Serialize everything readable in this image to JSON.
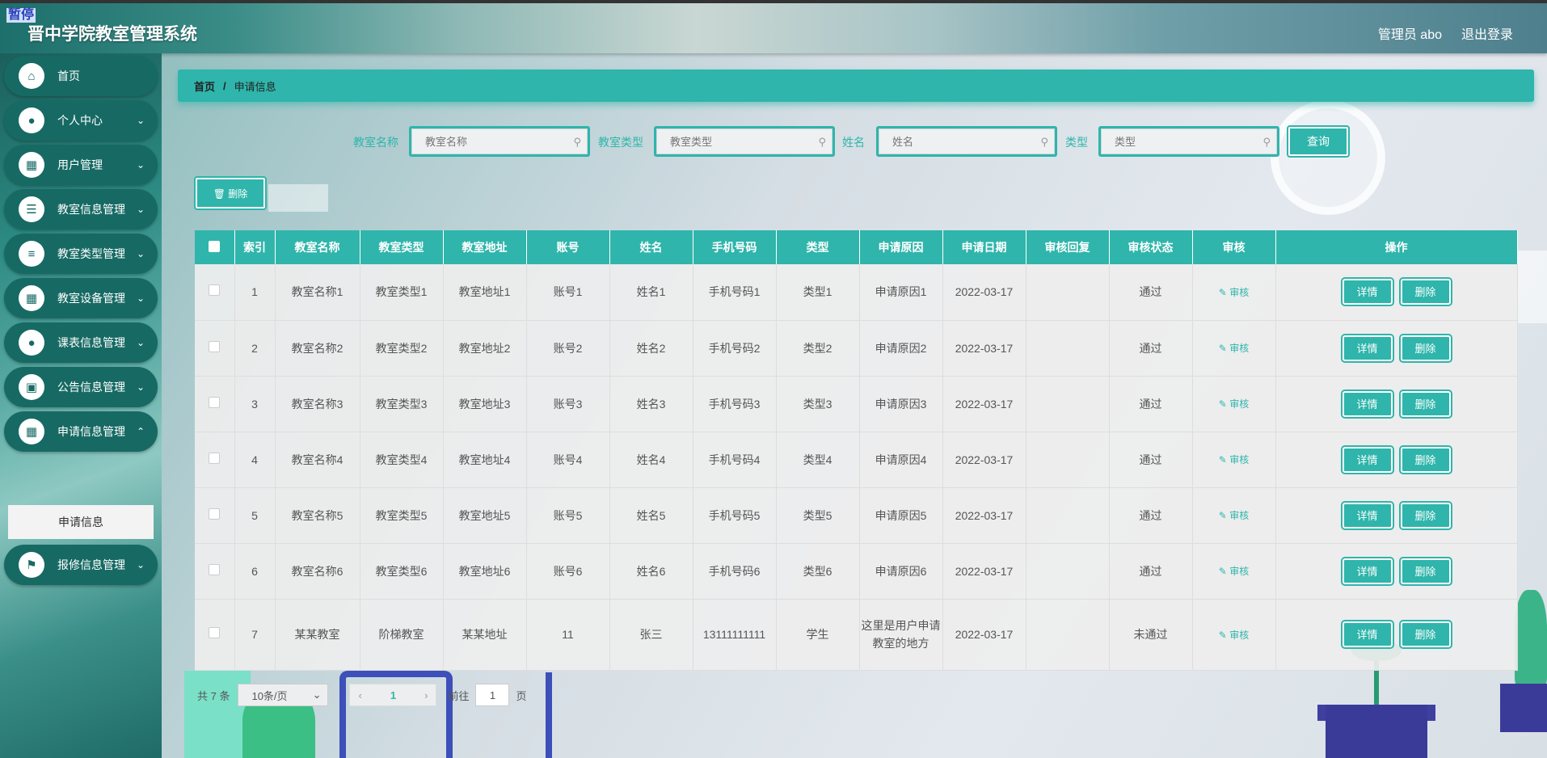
{
  "header": {
    "badge": "暂停",
    "title": "晋中学院教室管理系统",
    "user": "管理员 abo",
    "logout": "退出登录"
  },
  "sidebar": {
    "items": [
      {
        "label": "首页",
        "icon": "home-icon"
      },
      {
        "label": "个人中心",
        "icon": "user-icon"
      },
      {
        "label": "用户管理",
        "icon": "grid-icon"
      },
      {
        "label": "教室信息管理",
        "icon": "sliders-icon"
      },
      {
        "label": "教室类型管理",
        "icon": "list-icon"
      },
      {
        "label": "教室设备管理",
        "icon": "grid-icon"
      },
      {
        "label": "课表信息管理",
        "icon": "user-icon"
      },
      {
        "label": "公告信息管理",
        "icon": "briefcase-icon"
      },
      {
        "label": "申请信息管理",
        "icon": "grid-icon"
      },
      {
        "label": "报修信息管理",
        "icon": "flag-icon"
      }
    ],
    "submenu": "申请信息"
  },
  "breadcrumb": {
    "home": "首页",
    "separator": "/",
    "current": "申请信息"
  },
  "search": {
    "room_name_label": "教室名称",
    "room_name_placeholder": "教室名称",
    "room_type_label": "教室类型",
    "room_type_placeholder": "教室类型",
    "name_label": "姓名",
    "name_placeholder": "姓名",
    "type_label": "类型",
    "type_placeholder": "类型",
    "query_button": "查询"
  },
  "toolbar": {
    "delete_button": "删除"
  },
  "table": {
    "headers": [
      "索引",
      "教室名称",
      "教室类型",
      "教室地址",
      "账号",
      "姓名",
      "手机号码",
      "类型",
      "申请原因",
      "申请日期",
      "审核回复",
      "审核状态",
      "审核",
      "操作"
    ],
    "audit_link": "审核",
    "detail_button": "详情",
    "delete_button": "删除",
    "rows": [
      {
        "idx": "1",
        "room": "教室名称1",
        "rtype": "教室类型1",
        "addr": "教室地址1",
        "acct": "账号1",
        "name": "姓名1",
        "phone": "手机号码1",
        "type": "类型1",
        "reason": "申请原因1",
        "date": "2022-03-17",
        "reply": "",
        "status": "通过"
      },
      {
        "idx": "2",
        "room": "教室名称2",
        "rtype": "教室类型2",
        "addr": "教室地址2",
        "acct": "账号2",
        "name": "姓名2",
        "phone": "手机号码2",
        "type": "类型2",
        "reason": "申请原因2",
        "date": "2022-03-17",
        "reply": "",
        "status": "通过"
      },
      {
        "idx": "3",
        "room": "教室名称3",
        "rtype": "教室类型3",
        "addr": "教室地址3",
        "acct": "账号3",
        "name": "姓名3",
        "phone": "手机号码3",
        "type": "类型3",
        "reason": "申请原因3",
        "date": "2022-03-17",
        "reply": "",
        "status": "通过"
      },
      {
        "idx": "4",
        "room": "教室名称4",
        "rtype": "教室类型4",
        "addr": "教室地址4",
        "acct": "账号4",
        "name": "姓名4",
        "phone": "手机号码4",
        "type": "类型4",
        "reason": "申请原因4",
        "date": "2022-03-17",
        "reply": "",
        "status": "通过"
      },
      {
        "idx": "5",
        "room": "教室名称5",
        "rtype": "教室类型5",
        "addr": "教室地址5",
        "acct": "账号5",
        "name": "姓名5",
        "phone": "手机号码5",
        "type": "类型5",
        "reason": "申请原因5",
        "date": "2022-03-17",
        "reply": "",
        "status": "通过"
      },
      {
        "idx": "6",
        "room": "教室名称6",
        "rtype": "教室类型6",
        "addr": "教室地址6",
        "acct": "账号6",
        "name": "姓名6",
        "phone": "手机号码6",
        "type": "类型6",
        "reason": "申请原因6",
        "date": "2022-03-17",
        "reply": "",
        "status": "通过"
      },
      {
        "idx": "7",
        "room": "某某教室",
        "rtype": "阶梯教室",
        "addr": "某某地址",
        "acct": "11",
        "name": "张三",
        "phone": "13111111111",
        "type": "学生",
        "reason": "这里是用户申请教室的地方",
        "date": "2022-03-17",
        "reply": "",
        "status": "未通过"
      }
    ]
  },
  "pager": {
    "total": "共 7 条",
    "page_size": "10条/页",
    "current": "1",
    "goto_label": "前往",
    "goto_value": "1",
    "page_suffix": "页"
  },
  "colors": {
    "accent": "#2fb5ab",
    "sidebar_item": "#176a64"
  }
}
